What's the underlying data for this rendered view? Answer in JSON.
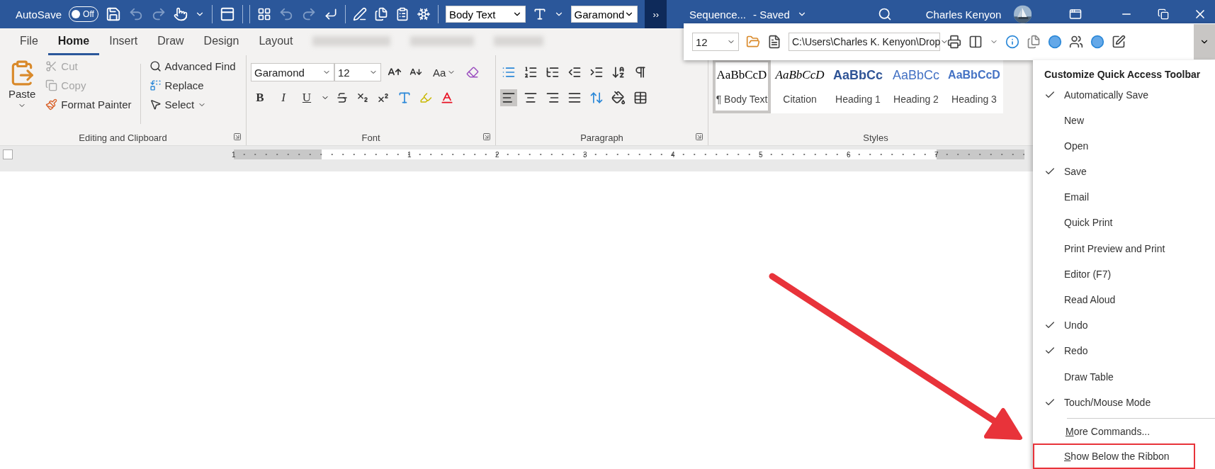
{
  "title_bar": {
    "autosave_label": "AutoSave",
    "autosave": {
      "on": false,
      "label": "Off"
    },
    "style_box": {
      "value": "Body Text"
    },
    "font_box": {
      "value": "Garamond"
    },
    "overflow_button": "››",
    "document_title": "Sequence...",
    "save_status": "- Saved",
    "user_name": "Charles Kenyon"
  },
  "qat_overflow": {
    "size_box": {
      "value": "12"
    },
    "path_box": {
      "value": "C:\\Users\\Charles K. Kenyon\\Drop"
    }
  },
  "tabs": [
    {
      "label": "File",
      "selected": false
    },
    {
      "label": "Home",
      "selected": true
    },
    {
      "label": "Insert",
      "selected": false
    },
    {
      "label": "Draw",
      "selected": false
    },
    {
      "label": "Design",
      "selected": false
    },
    {
      "label": "Layout",
      "selected": false
    }
  ],
  "clipboard_group": {
    "label": "Editing and Clipboard",
    "paste": "Paste",
    "commands": [
      {
        "kind": "cut",
        "label": "Cut",
        "disabled": true
      },
      {
        "kind": "copy",
        "label": "Copy",
        "disabled": true
      },
      {
        "kind": "painter",
        "label": "Format Painter",
        "disabled": false
      }
    ],
    "find_commands": [
      {
        "kind": "find",
        "label": "Advanced Find"
      },
      {
        "kind": "replace",
        "label": "Replace"
      },
      {
        "kind": "select",
        "label": "Select"
      }
    ]
  },
  "font_group": {
    "label": "Font",
    "font_name": "Garamond",
    "font_size": "12",
    "case_button": "Aa",
    "format_buttons": [
      "B",
      "I",
      "U"
    ]
  },
  "paragraph_group": {
    "label": "Paragraph",
    "alignment": [
      {
        "kind": "left",
        "selected": true
      },
      {
        "kind": "center",
        "selected": false
      },
      {
        "kind": "right",
        "selected": false
      },
      {
        "kind": "justify",
        "selected": false
      }
    ]
  },
  "styles_group": {
    "label": "Styles",
    "styles": [
      {
        "preview": "AaBbCcD",
        "name": "¶ Body Text",
        "kind": "serif",
        "selected": true
      },
      {
        "preview": "AaBbCcD",
        "name": "Citation",
        "kind": "italic",
        "selected": false
      },
      {
        "preview": "AaBbCc",
        "name": "Heading 1",
        "kind": "heading",
        "selected": false
      },
      {
        "preview": "AaBbCc",
        "name": "Heading 2",
        "kind": "light",
        "selected": false
      },
      {
        "preview": "AaBbCcD",
        "name": "Heading 3",
        "kind": "heading-small",
        "selected": false
      }
    ]
  },
  "ruler": {
    "labels": [
      "1",
      "1",
      "2",
      "3",
      "4",
      "5",
      "6",
      "7"
    ]
  },
  "qat_menu": {
    "title": "Customize Quick Access Toolbar",
    "items": [
      {
        "label": "Automatically Save",
        "checked": true
      },
      {
        "label": "New",
        "checked": false
      },
      {
        "label": "Open",
        "checked": false
      },
      {
        "label": "Save",
        "checked": true
      },
      {
        "label": "Email",
        "checked": false
      },
      {
        "label": "Quick Print",
        "checked": false
      },
      {
        "label": "Print Preview and Print",
        "checked": false
      },
      {
        "label": "Editor (F7)",
        "checked": false
      },
      {
        "label": "Read Aloud",
        "checked": false
      },
      {
        "label": "Undo",
        "checked": true
      },
      {
        "label": "Redo",
        "checked": true
      },
      {
        "label": "Draw Table",
        "checked": false
      },
      {
        "label": "Touch/Mouse Mode",
        "checked": true
      }
    ],
    "commands": [
      {
        "label": "More Commands...",
        "access_key": true,
        "highlighted": false
      },
      {
        "label": "Show Below the Ribbon",
        "access_key": true,
        "highlighted": true
      }
    ]
  }
}
